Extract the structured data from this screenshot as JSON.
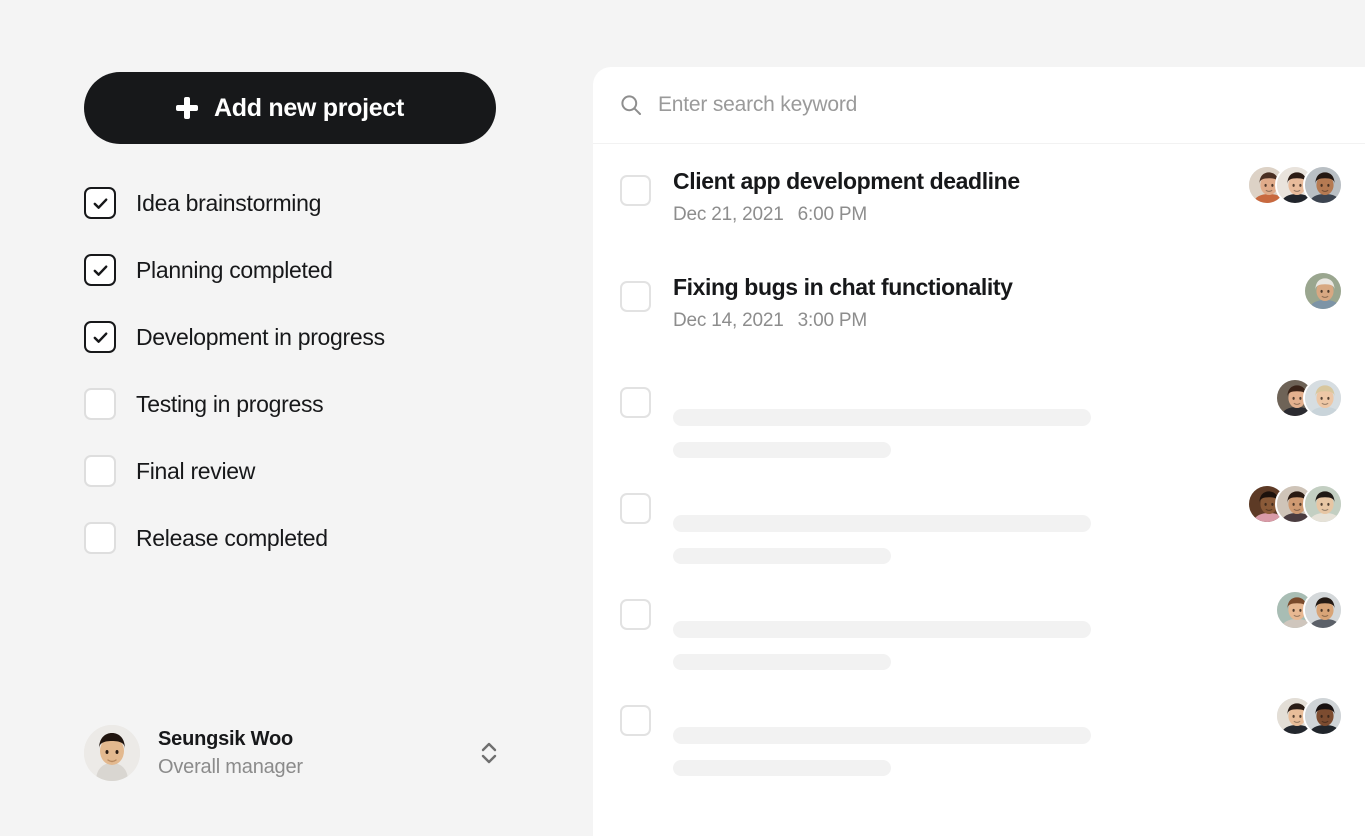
{
  "theme": {
    "page_bg": "#f4f4f4",
    "panel_bg": "#ffffff",
    "accent_dark": "#17181a",
    "muted_text": "#8d8d8d",
    "skeleton": "#f2f2f2"
  },
  "sidebar": {
    "add_button": {
      "label": "Add new project",
      "icon": "plus-icon"
    },
    "checklist": [
      {
        "label": "Idea brainstorming",
        "checked": true
      },
      {
        "label": "Planning completed",
        "checked": true
      },
      {
        "label": "Development in progress",
        "checked": true
      },
      {
        "label": "Testing in progress",
        "checked": false
      },
      {
        "label": "Final review",
        "checked": false
      },
      {
        "label": "Release completed",
        "checked": false
      }
    ],
    "profile": {
      "name": "Seungsik Woo",
      "role": "Overall manager",
      "avatar": "user-avatar",
      "selector_icon": "chevron-up-down-icon"
    }
  },
  "panel": {
    "search": {
      "placeholder": "Enter search keyword",
      "value": "",
      "icon": "search-icon"
    },
    "rows": [
      {
        "type": "task",
        "checked": false,
        "title": "Client app development deadline",
        "date": "Dec 21, 2021",
        "time": "6:00 PM",
        "avatar_count": 3,
        "avatars": [
          {
            "skin": "#e0ab8a",
            "hair": "#4a2f22",
            "shirt": "#c8693f",
            "bg": "#ddd2c6"
          },
          {
            "skin": "#e8bb9b",
            "hair": "#2c1c14",
            "shirt": "#20242b",
            "bg": "#e9e3dc"
          },
          {
            "skin": "#b57a52",
            "hair": "#241812",
            "shirt": "#3c4450",
            "bg": "#b9bfc4"
          }
        ]
      },
      {
        "type": "task",
        "checked": false,
        "title": "Fixing bugs in chat functionality",
        "date": "Dec 14, 2021",
        "time": "3:00 PM",
        "avatar_count": 1,
        "avatars": [
          {
            "skin": "#d8a882",
            "hair": "#e9e6e1",
            "shirt": "#7d94a6",
            "bg": "#9aa68f"
          }
        ]
      },
      {
        "type": "skeleton",
        "checked": false,
        "avatar_count": 2,
        "avatars": [
          {
            "skin": "#e3b08e",
            "hair": "#3a2318",
            "shirt": "#2b2b30",
            "bg": "#6e6357"
          },
          {
            "skin": "#edc7a6",
            "hair": "#d8c79e",
            "shirt": "#c9d4da",
            "bg": "#d6dde1"
          }
        ]
      },
      {
        "type": "skeleton",
        "checked": false,
        "avatar_count": 3,
        "avatars": [
          {
            "skin": "#8a5a38",
            "hair": "#1d120c",
            "shirt": "#d99ba8",
            "bg": "#5d3a25"
          },
          {
            "skin": "#cf9a72",
            "hair": "#2a1a12",
            "shirt": "#4a3c40",
            "bg": "#cfc4b8"
          },
          {
            "skin": "#e7c6a4",
            "hair": "#201a16",
            "shirt": "#e6e2d8",
            "bg": "#c3cfc2"
          }
        ]
      },
      {
        "type": "skeleton",
        "checked": false,
        "avatar_count": 2,
        "avatars": [
          {
            "skin": "#e8b892",
            "hair": "#7a4a2c",
            "shirt": "#cfc6bd",
            "bg": "#a8bdb4"
          },
          {
            "skin": "#d8a477",
            "hair": "#241a14",
            "shirt": "#5b6068",
            "bg": "#d4d8da"
          }
        ]
      },
      {
        "type": "skeleton",
        "checked": false,
        "avatar_count": 2,
        "avatars": [
          {
            "skin": "#e8bd99",
            "hair": "#2a1d16",
            "shirt": "#23272e",
            "bg": "#e3ded6"
          },
          {
            "skin": "#7c4c30",
            "hair": "#171010",
            "shirt": "#20252b",
            "bg": "#cfd4d7"
          }
        ]
      }
    ]
  }
}
